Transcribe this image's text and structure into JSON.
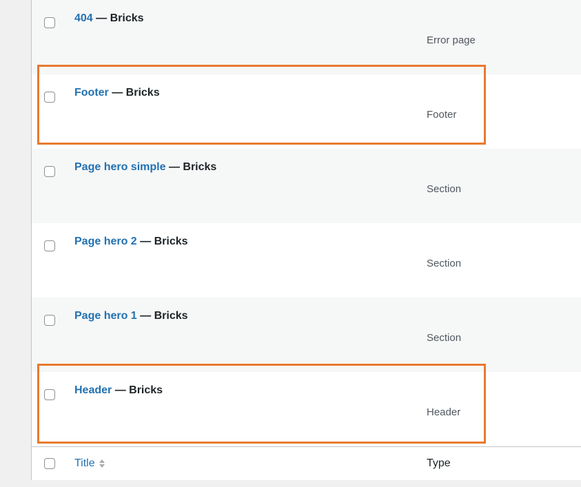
{
  "rows": [
    {
      "title": "404",
      "suffix": " — Bricks",
      "type": "Error page"
    },
    {
      "title": "Footer",
      "suffix": " — Bricks",
      "type": "Footer"
    },
    {
      "title": "Page hero simple",
      "suffix": " — Bricks",
      "type": "Section"
    },
    {
      "title": "Page hero 2",
      "suffix": " — Bricks",
      "type": "Section"
    },
    {
      "title": "Page hero 1",
      "suffix": " — Bricks",
      "type": "Section"
    },
    {
      "title": "Header",
      "suffix": " — Bricks",
      "type": "Header"
    }
  ],
  "footer": {
    "title_label": "Title",
    "type_label": "Type",
    "sort_icon": "sort-arrows-icon"
  },
  "colors": {
    "link": "#2271b1",
    "highlight": "#e87a2f",
    "alt_row": "#f6f7f7"
  }
}
